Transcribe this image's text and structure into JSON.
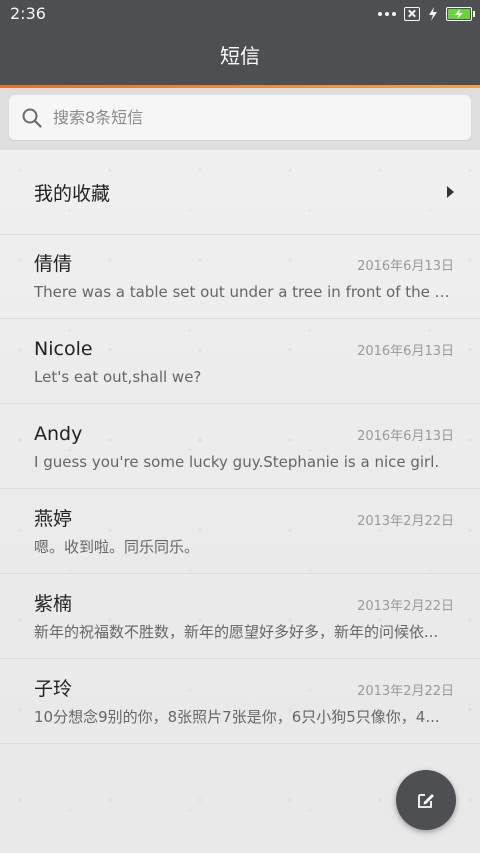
{
  "status_bar": {
    "time": "2:36"
  },
  "header": {
    "title": "短信"
  },
  "search": {
    "placeholder": "搜索8条短信"
  },
  "favorites": {
    "label": "我的收藏"
  },
  "conversations": [
    {
      "name": "倩倩",
      "date": "2016年6月13日",
      "preview": "There was a table set out under a tree in front of the hous"
    },
    {
      "name": "Nicole",
      "date": "2016年6月13日",
      "preview": "Let's eat out,shall we?"
    },
    {
      "name": "Andy",
      "date": "2016年6月13日",
      "preview": "I guess you're some lucky guy.Stephanie is a nice girl."
    },
    {
      "name": "燕婷",
      "date": "2013年2月22日",
      "preview": "嗯。收到啦。同乐同乐。"
    },
    {
      "name": "紫楠",
      "date": "2013年2月22日",
      "preview": "新年的祝福数不胜数，新年的愿望好多好多，新年的问候依..."
    },
    {
      "name": "子玲",
      "date": "2013年2月22日",
      "preview": "10分想念9别的你，8张照片7张是你，6只小狗5只像你，4..."
    }
  ],
  "colors": {
    "header_bg": "#4d4f53",
    "accent": "#e8702a",
    "battery": "#6bd23b"
  },
  "icons": {
    "search": "search-icon",
    "compose": "compose-icon",
    "favorites": "chevron-right-icon"
  }
}
